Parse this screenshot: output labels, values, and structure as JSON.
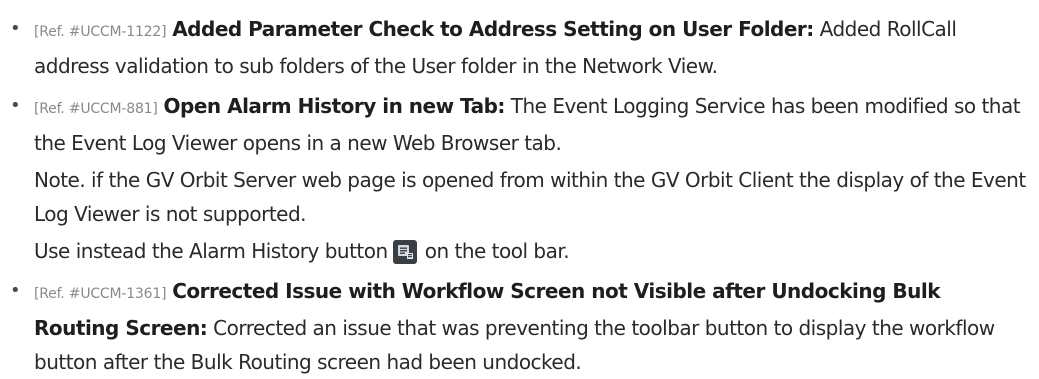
{
  "notes": [
    {
      "ref": "[Ref. #UCCM-1122]",
      "title": "Added Parameter Check to Address Setting on User Folder:",
      "body": "Added RollCall address validation to sub folders of the User folder in the Network View."
    },
    {
      "ref": "[Ref. #UCCM-881]",
      "title": "Open Alarm History in new Tab:",
      "body": "The Event Logging Service has been modified so that the Event Log Viewer opens in a new Web Browser tab.",
      "note_text": "Note. if the GV Orbit Server web page is opened from within the GV Orbit Client the display of the Event Log Viewer is not supported.",
      "instruction_before": "Use instead the Alarm History button",
      "instruction_icon": "alarm-history-icon",
      "instruction_after": "on the tool bar."
    },
    {
      "ref": "[Ref. #UCCM-1361]",
      "title": "Corrected Issue with Workflow Screen not Visible after Undocking Bulk Routing Screen:",
      "body": "Corrected an issue that was preventing the toolbar button to display the workflow button after the Bulk Routing screen had been undocked."
    }
  ],
  "colors": {
    "text": "#2a2a2a",
    "ref": "#8a8a8a",
    "icon_bg": "#3a3f46"
  }
}
